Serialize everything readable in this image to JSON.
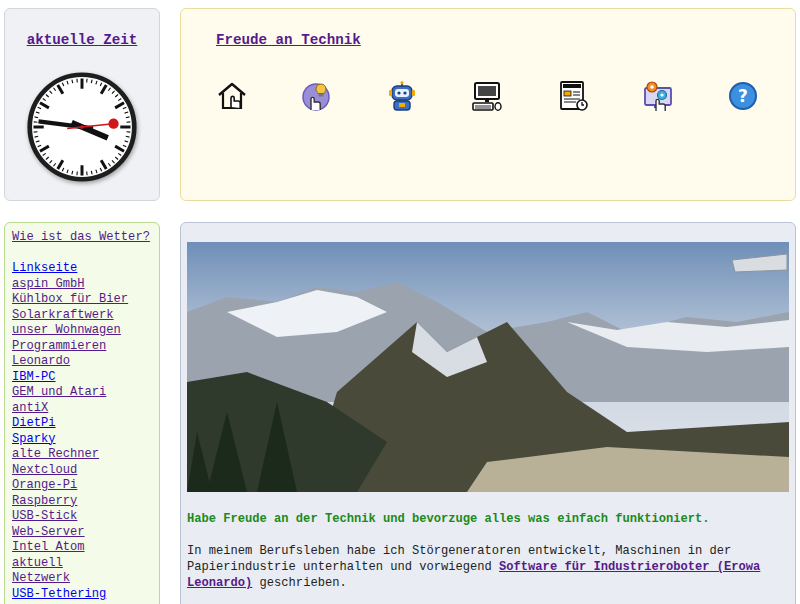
{
  "clock_widget": {
    "title": "aktuelle Zeit",
    "visited": true,
    "hours": 3,
    "minutes": 46,
    "seconds": 14
  },
  "header": {
    "title": "Freude an Technik",
    "visited": true,
    "help_glyph": "?"
  },
  "sidebar": {
    "weather_link": {
      "label": "Wie ist das Wetter?",
      "visited": true
    },
    "items": [
      {
        "label": "Linkseite",
        "visited": false
      },
      {
        "label": "aspin GmbH",
        "visited": true
      },
      {
        "label": "Kühlbox für Bier",
        "visited": true
      },
      {
        "label": "Solarkraftwerk",
        "visited": true
      },
      {
        "label": "unser Wohnwagen",
        "visited": true
      },
      {
        "label": "Programmieren",
        "visited": true
      },
      {
        "label": "Leonardo",
        "visited": true
      },
      {
        "label": "IBM-PC",
        "visited": false
      },
      {
        "label": "GEM und Atari",
        "visited": true
      },
      {
        "label": "antiX",
        "visited": true
      },
      {
        "label": "DietPi",
        "visited": false
      },
      {
        "label": "Sparky",
        "visited": false
      },
      {
        "label": "alte Rechner",
        "visited": true
      },
      {
        "label": "Nextcloud",
        "visited": true
      },
      {
        "label": "Orange-Pi",
        "visited": true
      },
      {
        "label": "Raspberry",
        "visited": true
      },
      {
        "label": "USB-Stick",
        "visited": true
      },
      {
        "label": "Web-Server",
        "visited": true
      },
      {
        "label": "Intel Atom",
        "visited": true
      },
      {
        "label": "aktuell",
        "visited": true
      },
      {
        "label": "Netzwerk",
        "visited": true
      },
      {
        "label": "USB-Tethering",
        "visited": false
      }
    ]
  },
  "main": {
    "tagline": "Habe Freude an der Technik und bevorzuge alles was einfach funktioniert.",
    "intro_before": "In meinem Berufsleben habe ich Störgeneratoren entwickelt, Maschinen in der Papierindustrie unterhalten und vorwiegend ",
    "intro_link": {
      "label": "Software für Industrieroboter (Erowa Leonardo)",
      "visited": true
    },
    "intro_after": " geschrieben."
  }
}
